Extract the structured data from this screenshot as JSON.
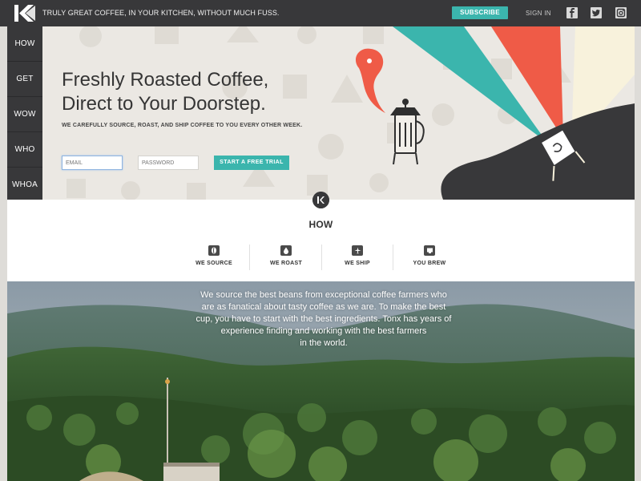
{
  "topbar": {
    "tagline": "TRULY GREAT COFFEE, IN YOUR KITCHEN, WITHOUT MUCH FUSS.",
    "subscribe_label": "SUBSCRIBE",
    "signin_label": "SIGN IN",
    "social_icons": [
      "facebook-icon",
      "twitter-icon",
      "instagram-icon"
    ]
  },
  "sidenav": {
    "items": [
      {
        "label": "HOW"
      },
      {
        "label": "GET"
      },
      {
        "label": "WOW"
      },
      {
        "label": "WHO"
      },
      {
        "label": "WHOA"
      }
    ]
  },
  "hero": {
    "heading_line1": "Freshly Roasted Coffee,",
    "heading_line2": "Direct to Your Doorstep.",
    "subheading": "WE CAREFULLY SOURCE, ROAST, AND SHIP COFFEE TO YOU EVERY OTHER WEEK.",
    "email_placeholder": "EMAIL",
    "password_placeholder": "PASSWORD",
    "cta_label": "START A FREE TRIAL"
  },
  "how": {
    "title": "HOW",
    "steps": [
      {
        "label": "WE SOURCE",
        "icon": "bean-icon"
      },
      {
        "label": "WE ROAST",
        "icon": "drop-icon"
      },
      {
        "label": "WE SHIP",
        "icon": "plane-icon"
      },
      {
        "label": "YOU BREW",
        "icon": "cup-icon"
      }
    ]
  },
  "photo": {
    "text_line1": "We source the best beans from exceptional coffee farmers who",
    "text_line2": "are as fanatical about tasty coffee as we are. To make the best",
    "text_line3": "cup, you have to start with the best ingredients. Tonx has years of",
    "text_line4": "experience finding and working with the best farmers",
    "text_line5": "in the world."
  },
  "colors": {
    "accent": "#3bb5ad",
    "dark": "#38383a",
    "coral": "#ef5b47",
    "cream": "#f8f2dc"
  }
}
